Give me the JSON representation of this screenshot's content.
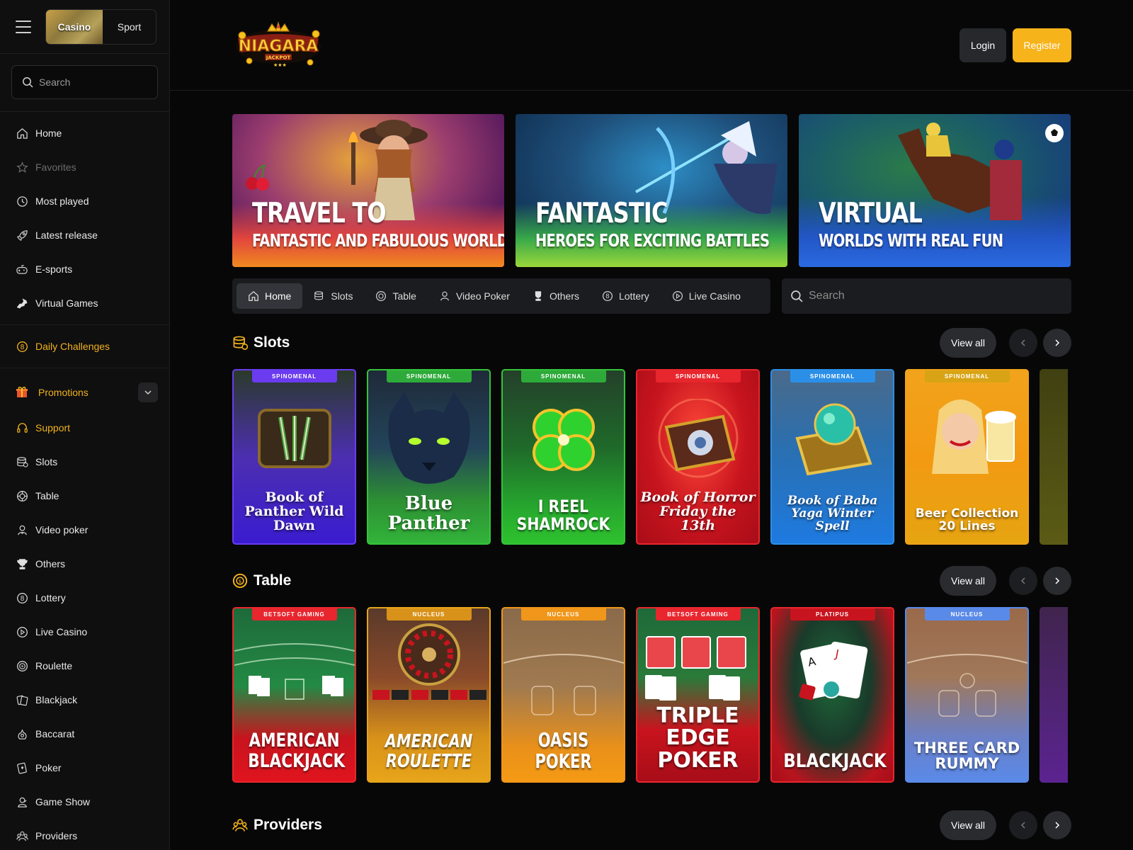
{
  "sidebar": {
    "mode": {
      "casino": "Casino",
      "sport": "Sport"
    },
    "search_placeholder": "Search",
    "primary": [
      {
        "label": "Home",
        "icon": "home-icon"
      },
      {
        "label": "Favorites",
        "icon": "star-icon"
      },
      {
        "label": "Most played",
        "icon": "clock-icon"
      },
      {
        "label": "Latest release",
        "icon": "rocket-icon"
      },
      {
        "label": "E-sports",
        "icon": "gamepad-icon"
      },
      {
        "label": "Virtual Games",
        "icon": "horse-icon"
      }
    ],
    "daily_challenges": "Daily Challenges",
    "promotions": "Promotions",
    "support": "Support",
    "categories": [
      {
        "label": "Slots",
        "icon": "coins-icon"
      },
      {
        "label": "Table",
        "icon": "chip-icon"
      },
      {
        "label": "Video poker",
        "icon": "dealer-icon"
      },
      {
        "label": "Others",
        "icon": "trophy-icon"
      },
      {
        "label": "Lottery",
        "icon": "lottery-ball-icon"
      },
      {
        "label": "Live Casino",
        "icon": "play-circle-icon"
      },
      {
        "label": "Roulette",
        "icon": "roulette-icon"
      },
      {
        "label": "Blackjack",
        "icon": "cards-icon"
      },
      {
        "label": "Baccarat",
        "icon": "baccarat-icon"
      },
      {
        "label": "Poker",
        "icon": "poker-icon"
      },
      {
        "label": "Game Show",
        "icon": "host-icon"
      },
      {
        "label": "Providers",
        "icon": "providers-icon"
      }
    ]
  },
  "header": {
    "logo_text": "NIAGARA",
    "logo_sub": "JACKPOT",
    "login": "Login",
    "register": "Register"
  },
  "banners": [
    {
      "title": "TRAVEL TO",
      "subtitle": "FANTASTIC AND FABULOUS WORLDS"
    },
    {
      "title": "FANTASTIC",
      "subtitle": "HEROES FOR EXCITING BATTLES"
    },
    {
      "title": "VIRTUAL",
      "subtitle": "WORLDS WITH REAL FUN"
    }
  ],
  "category_tabs": [
    {
      "label": "Home",
      "icon": "home-icon"
    },
    {
      "label": "Slots",
      "icon": "coins-icon"
    },
    {
      "label": "Table",
      "icon": "chip-icon"
    },
    {
      "label": "Video Poker",
      "icon": "dealer-icon"
    },
    {
      "label": "Others",
      "icon": "trophy-icon"
    },
    {
      "label": "Lottery",
      "icon": "lottery-ball-icon"
    },
    {
      "label": "Live Casino",
      "icon": "play-circle-icon"
    }
  ],
  "main_search_placeholder": "Search",
  "sections": {
    "slots": {
      "title": "Slots",
      "view_all": "View all",
      "games": [
        {
          "provider": "SPINOMENAL",
          "title": "Book of Panther Wild Dawn"
        },
        {
          "provider": "SPINOMENAL",
          "title": "Blue Panther"
        },
        {
          "provider": "SPINOMENAL",
          "title": "I REEL SHAMROCK"
        },
        {
          "provider": "SPINOMENAL",
          "title": "Book of Horror Friday the 13th"
        },
        {
          "provider": "SPINOMENAL",
          "title": "Book of Baba Yaga Winter Spell"
        },
        {
          "provider": "SPINOMENAL",
          "title": "Beer Collection 20 Lines"
        }
      ]
    },
    "table": {
      "title": "Table",
      "view_all": "View all",
      "games": [
        {
          "provider": "BETSOFT GAMING",
          "title": "AMERICAN BLACKJACK"
        },
        {
          "provider": "NUCLEUS",
          "title": "AMERICAN ROULETTE"
        },
        {
          "provider": "NUCLEUS",
          "title": "OASIS POKER"
        },
        {
          "provider": "BETSOFT GAMING",
          "title": "TRIPLE EDGE POKER"
        },
        {
          "provider": "PLATIPUS",
          "title": "BLACKJACK"
        },
        {
          "provider": "NUCLEUS",
          "title": "THREE CARD RUMMY"
        }
      ]
    },
    "providers": {
      "title": "Providers",
      "view_all": "View all"
    }
  },
  "colors": {
    "accent": "#f7b31a",
    "background": "#070707",
    "sidebar": "#0f0f10"
  }
}
